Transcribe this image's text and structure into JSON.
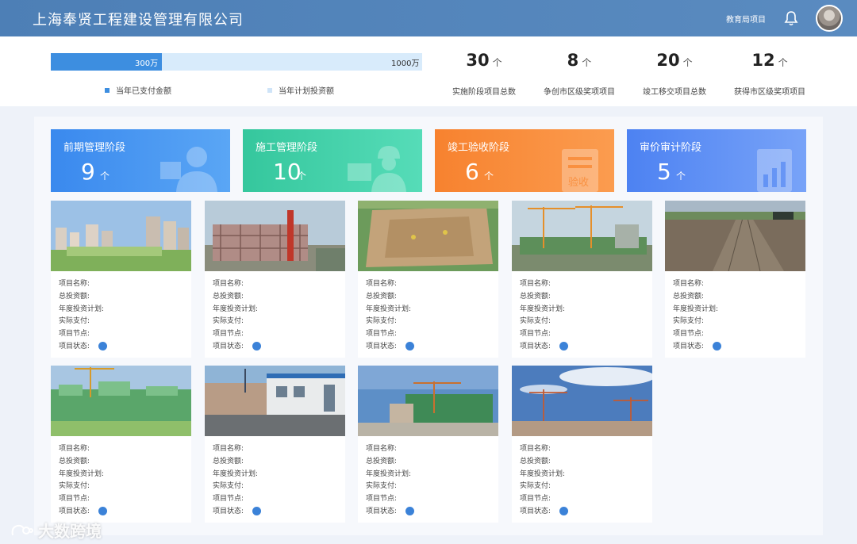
{
  "header": {
    "title": "上海奉贤工程建设管理有限公司",
    "dept_label": "教育局项目",
    "bell_icon": "bell-icon",
    "avatar_icon": "user-avatar"
  },
  "investment": {
    "paid_label": "300万",
    "plan_label": "1000万",
    "paid_value": 300,
    "plan_value": 1000,
    "legend_paid": "当年已支付金额",
    "legend_plan": "当年计划投资额",
    "paid_color": "#3d8ee0",
    "plan_color": "#d8ebfb"
  },
  "kpis": [
    {
      "value": "30",
      "unit": "个",
      "label": "实施阶段项目总数"
    },
    {
      "value": "8",
      "unit": "个",
      "label": "争创市区级奖项项目"
    },
    {
      "value": "20",
      "unit": "个",
      "label": "竣工移交项目总数"
    },
    {
      "value": "12",
      "unit": "个",
      "label": "获得市区级奖项项目"
    }
  ],
  "stages": [
    {
      "title": "前期管理阶段",
      "count": "9",
      "unit": "个",
      "icon": "person-icon",
      "color": "#3e8ef0"
    },
    {
      "title": "施工管理阶段",
      "count": "10",
      "unit": "个",
      "icon": "worker-icon",
      "color": "#3ccfa8"
    },
    {
      "title": "竣工验收阶段",
      "count": "6",
      "unit": "个",
      "icon": "acceptance-icon",
      "color": "#f9873a"
    },
    {
      "title": "审价审计阶段",
      "count": "5",
      "unit": "个",
      "icon": "report-chart-icon",
      "color": "#5f8ff5"
    }
  ],
  "stage_deco_text": "验收",
  "card_fields": {
    "name": "项目名称:",
    "total": "总投资额:",
    "plan": "年度投资计划:",
    "paid": "实际支付:",
    "node": "项目节点:",
    "status": "项目状态:"
  },
  "status_color": "#3b82d8",
  "projects": [
    {
      "photo": "residential-towers"
    },
    {
      "photo": "building-frame"
    },
    {
      "photo": "excavation-site"
    },
    {
      "photo": "crane-site"
    },
    {
      "photo": "muddy-ground"
    },
    {
      "photo": "green-netted-building"
    },
    {
      "photo": "site-office"
    },
    {
      "photo": "crane-green-building"
    },
    {
      "photo": "cranes-sky"
    }
  ],
  "watermark": "大数跨境"
}
